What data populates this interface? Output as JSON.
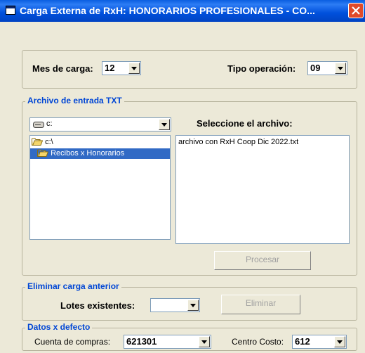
{
  "window": {
    "title": "Carga Externa de RxH: HONORARIOS PROFESIONALES - CO..."
  },
  "header": {
    "mes_label": "Mes de carga:",
    "mes_value": "12",
    "tipo_label": "Tipo operación:",
    "tipo_value": "09"
  },
  "archivo": {
    "legend": "Archivo de entrada TXT",
    "drive": "c:",
    "dirs": [
      "c:\\",
      "Recibos x Honorarios"
    ],
    "select_label": "Seleccione el archivo:",
    "files": [
      "archivo con RxH Coop  Dic 2022.txt"
    ],
    "procesar_label": "Procesar"
  },
  "eliminar": {
    "legend": "Eliminar carga anterior",
    "lotes_label": "Lotes existentes:",
    "lotes_value": "",
    "eliminar_label": "Eliminar"
  },
  "defaults": {
    "legend": "Datos x defecto",
    "cuenta_label": "Cuenta de compras:",
    "cuenta_value": "621301",
    "centro_label": "Centro Costo:",
    "centro_value": "612"
  },
  "colors": {
    "title_bar": "#0054e3",
    "group_legend": "#0046d5",
    "selection": "#316ac5",
    "close_button": "#e04a2a"
  }
}
